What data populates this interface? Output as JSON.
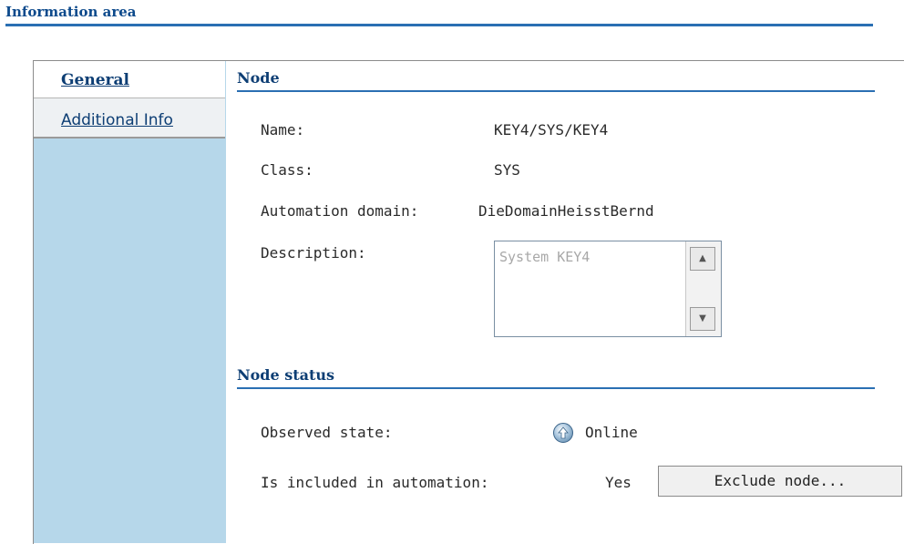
{
  "header": {
    "title": "Information area"
  },
  "sidebar": {
    "tabs": [
      {
        "label": "General"
      },
      {
        "label": "Additional Info"
      }
    ]
  },
  "node": {
    "section_title": "Node",
    "name_label": "Name:",
    "name_value": "KEY4/SYS/KEY4",
    "class_label": "Class:",
    "class_value": "SYS",
    "domain_label": "Automation domain:",
    "domain_value": "DieDomainHeisstBernd",
    "description_label": "Description:",
    "description_value": "System KEY4"
  },
  "status": {
    "section_title": "Node status",
    "observed_label": "Observed state:",
    "observed_value": "Online",
    "included_label": "Is included in automation:",
    "included_value": "Yes",
    "exclude_button": "Exclude node..."
  },
  "colors": {
    "accent": "#2a6fb3",
    "sidebar_bg": "#b6d7ea",
    "heading": "#0d3e74"
  }
}
